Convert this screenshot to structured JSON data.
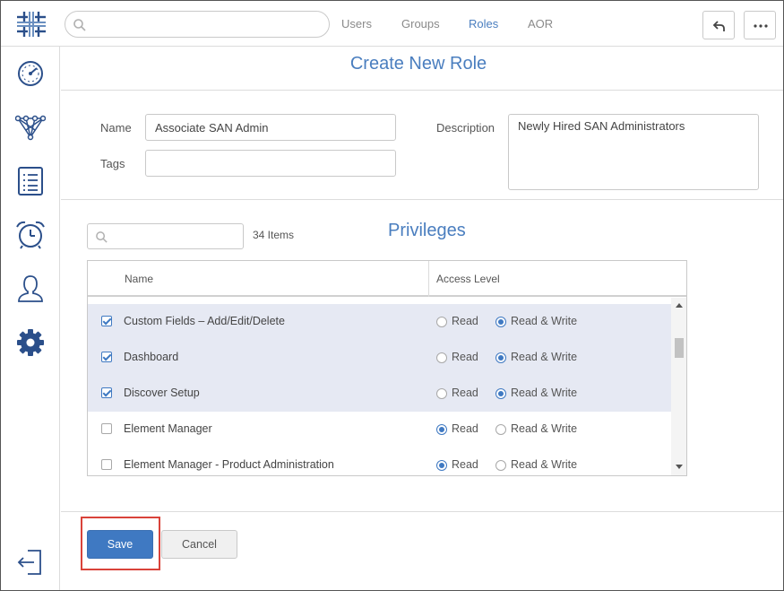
{
  "topbar": {
    "search_placeholder": "",
    "nav": [
      "Users",
      "Groups",
      "Roles",
      "AOR"
    ],
    "active_nav": "Roles"
  },
  "sidebar": {
    "items": [
      "dashboard",
      "topology",
      "reports",
      "alarms",
      "users",
      "settings"
    ],
    "active": "settings",
    "bottom": "logout"
  },
  "form": {
    "title": "Create New Role",
    "name_label": "Name",
    "name_value": "Associate SAN Admin",
    "tags_label": "Tags",
    "tags_value": "",
    "description_label": "Description",
    "description_value": "Newly Hired SAN Administrators"
  },
  "privileges": {
    "title": "Privileges",
    "search_value": "",
    "count": "34 Items",
    "col_name": "Name",
    "col_access": "Access Level",
    "read_label": "Read",
    "rw_label": "Read & Write",
    "rows": [
      {
        "name": "Custom Fields – Add/Edit/Delete",
        "checked": true,
        "access": "Read & Write"
      },
      {
        "name": "Dashboard",
        "checked": true,
        "access": "Read & Write"
      },
      {
        "name": "Discover Setup",
        "checked": true,
        "access": "Read & Write"
      },
      {
        "name": "Element Manager",
        "checked": false,
        "access": "Read"
      },
      {
        "name": "Element Manager - Product Administration",
        "checked": false,
        "access": "Read"
      }
    ]
  },
  "buttons": {
    "save": "Save",
    "cancel": "Cancel"
  },
  "colors": {
    "accent": "#3f79c2",
    "title": "#4a7ebf",
    "selected_row": "#e6e9f3",
    "highlight": "#d9433a",
    "sidebar_icon": "#2b4f8a"
  }
}
